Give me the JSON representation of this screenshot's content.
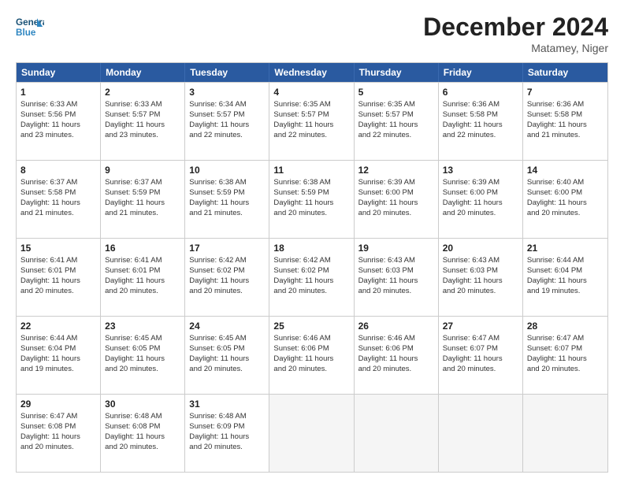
{
  "logo": {
    "line1": "General",
    "line2": "Blue"
  },
  "title": "December 2024",
  "subtitle": "Matamey, Niger",
  "header_days": [
    "Sunday",
    "Monday",
    "Tuesday",
    "Wednesday",
    "Thursday",
    "Friday",
    "Saturday"
  ],
  "weeks": [
    [
      {
        "day": "1",
        "lines": [
          "Sunrise: 6:33 AM",
          "Sunset: 5:56 PM",
          "Daylight: 11 hours",
          "and 23 minutes."
        ]
      },
      {
        "day": "2",
        "lines": [
          "Sunrise: 6:33 AM",
          "Sunset: 5:57 PM",
          "Daylight: 11 hours",
          "and 23 minutes."
        ]
      },
      {
        "day": "3",
        "lines": [
          "Sunrise: 6:34 AM",
          "Sunset: 5:57 PM",
          "Daylight: 11 hours",
          "and 22 minutes."
        ]
      },
      {
        "day": "4",
        "lines": [
          "Sunrise: 6:35 AM",
          "Sunset: 5:57 PM",
          "Daylight: 11 hours",
          "and 22 minutes."
        ]
      },
      {
        "day": "5",
        "lines": [
          "Sunrise: 6:35 AM",
          "Sunset: 5:57 PM",
          "Daylight: 11 hours",
          "and 22 minutes."
        ]
      },
      {
        "day": "6",
        "lines": [
          "Sunrise: 6:36 AM",
          "Sunset: 5:58 PM",
          "Daylight: 11 hours",
          "and 22 minutes."
        ]
      },
      {
        "day": "7",
        "lines": [
          "Sunrise: 6:36 AM",
          "Sunset: 5:58 PM",
          "Daylight: 11 hours",
          "and 21 minutes."
        ]
      }
    ],
    [
      {
        "day": "8",
        "lines": [
          "Sunrise: 6:37 AM",
          "Sunset: 5:58 PM",
          "Daylight: 11 hours",
          "and 21 minutes."
        ]
      },
      {
        "day": "9",
        "lines": [
          "Sunrise: 6:37 AM",
          "Sunset: 5:59 PM",
          "Daylight: 11 hours",
          "and 21 minutes."
        ]
      },
      {
        "day": "10",
        "lines": [
          "Sunrise: 6:38 AM",
          "Sunset: 5:59 PM",
          "Daylight: 11 hours",
          "and 21 minutes."
        ]
      },
      {
        "day": "11",
        "lines": [
          "Sunrise: 6:38 AM",
          "Sunset: 5:59 PM",
          "Daylight: 11 hours",
          "and 20 minutes."
        ]
      },
      {
        "day": "12",
        "lines": [
          "Sunrise: 6:39 AM",
          "Sunset: 6:00 PM",
          "Daylight: 11 hours",
          "and 20 minutes."
        ]
      },
      {
        "day": "13",
        "lines": [
          "Sunrise: 6:39 AM",
          "Sunset: 6:00 PM",
          "Daylight: 11 hours",
          "and 20 minutes."
        ]
      },
      {
        "day": "14",
        "lines": [
          "Sunrise: 6:40 AM",
          "Sunset: 6:00 PM",
          "Daylight: 11 hours",
          "and 20 minutes."
        ]
      }
    ],
    [
      {
        "day": "15",
        "lines": [
          "Sunrise: 6:41 AM",
          "Sunset: 6:01 PM",
          "Daylight: 11 hours",
          "and 20 minutes."
        ]
      },
      {
        "day": "16",
        "lines": [
          "Sunrise: 6:41 AM",
          "Sunset: 6:01 PM",
          "Daylight: 11 hours",
          "and 20 minutes."
        ]
      },
      {
        "day": "17",
        "lines": [
          "Sunrise: 6:42 AM",
          "Sunset: 6:02 PM",
          "Daylight: 11 hours",
          "and 20 minutes."
        ]
      },
      {
        "day": "18",
        "lines": [
          "Sunrise: 6:42 AM",
          "Sunset: 6:02 PM",
          "Daylight: 11 hours",
          "and 20 minutes."
        ]
      },
      {
        "day": "19",
        "lines": [
          "Sunrise: 6:43 AM",
          "Sunset: 6:03 PM",
          "Daylight: 11 hours",
          "and 20 minutes."
        ]
      },
      {
        "day": "20",
        "lines": [
          "Sunrise: 6:43 AM",
          "Sunset: 6:03 PM",
          "Daylight: 11 hours",
          "and 20 minutes."
        ]
      },
      {
        "day": "21",
        "lines": [
          "Sunrise: 6:44 AM",
          "Sunset: 6:04 PM",
          "Daylight: 11 hours",
          "and 19 minutes."
        ]
      }
    ],
    [
      {
        "day": "22",
        "lines": [
          "Sunrise: 6:44 AM",
          "Sunset: 6:04 PM",
          "Daylight: 11 hours",
          "and 19 minutes."
        ]
      },
      {
        "day": "23",
        "lines": [
          "Sunrise: 6:45 AM",
          "Sunset: 6:05 PM",
          "Daylight: 11 hours",
          "and 20 minutes."
        ]
      },
      {
        "day": "24",
        "lines": [
          "Sunrise: 6:45 AM",
          "Sunset: 6:05 PM",
          "Daylight: 11 hours",
          "and 20 minutes."
        ]
      },
      {
        "day": "25",
        "lines": [
          "Sunrise: 6:46 AM",
          "Sunset: 6:06 PM",
          "Daylight: 11 hours",
          "and 20 minutes."
        ]
      },
      {
        "day": "26",
        "lines": [
          "Sunrise: 6:46 AM",
          "Sunset: 6:06 PM",
          "Daylight: 11 hours",
          "and 20 minutes."
        ]
      },
      {
        "day": "27",
        "lines": [
          "Sunrise: 6:47 AM",
          "Sunset: 6:07 PM",
          "Daylight: 11 hours",
          "and 20 minutes."
        ]
      },
      {
        "day": "28",
        "lines": [
          "Sunrise: 6:47 AM",
          "Sunset: 6:07 PM",
          "Daylight: 11 hours",
          "and 20 minutes."
        ]
      }
    ],
    [
      {
        "day": "29",
        "lines": [
          "Sunrise: 6:47 AM",
          "Sunset: 6:08 PM",
          "Daylight: 11 hours",
          "and 20 minutes."
        ]
      },
      {
        "day": "30",
        "lines": [
          "Sunrise: 6:48 AM",
          "Sunset: 6:08 PM",
          "Daylight: 11 hours",
          "and 20 minutes."
        ]
      },
      {
        "day": "31",
        "lines": [
          "Sunrise: 6:48 AM",
          "Sunset: 6:09 PM",
          "Daylight: 11 hours",
          "and 20 minutes."
        ]
      },
      null,
      null,
      null,
      null
    ]
  ]
}
